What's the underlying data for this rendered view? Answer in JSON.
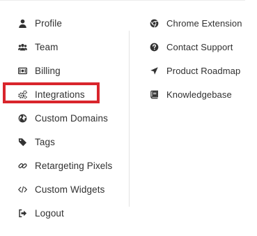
{
  "left_menu": {
    "items": [
      {
        "label": "Profile",
        "icon": "user-icon"
      },
      {
        "label": "Team",
        "icon": "users-icon"
      },
      {
        "label": "Billing",
        "icon": "money-bill-icon"
      },
      {
        "label": "Integrations",
        "icon": "cogs-icon"
      },
      {
        "label": "Custom Domains",
        "icon": "globe-icon"
      },
      {
        "label": "Tags",
        "icon": "tag-icon"
      },
      {
        "label": "Retargeting Pixels",
        "icon": "link-icon"
      },
      {
        "label": "Custom Widgets",
        "icon": "code-icon"
      },
      {
        "label": "Logout",
        "icon": "sign-out-icon"
      }
    ]
  },
  "right_menu": {
    "items": [
      {
        "label": "Chrome Extension",
        "icon": "chrome-icon"
      },
      {
        "label": "Contact Support",
        "icon": "question-circle-icon"
      },
      {
        "label": "Product Roadmap",
        "icon": "location-arrow-icon"
      },
      {
        "label": "Knowledgebase",
        "icon": "book-icon"
      }
    ]
  },
  "colors": {
    "text": "#303030",
    "icon": "#333333",
    "highlight": "#d9252c"
  }
}
